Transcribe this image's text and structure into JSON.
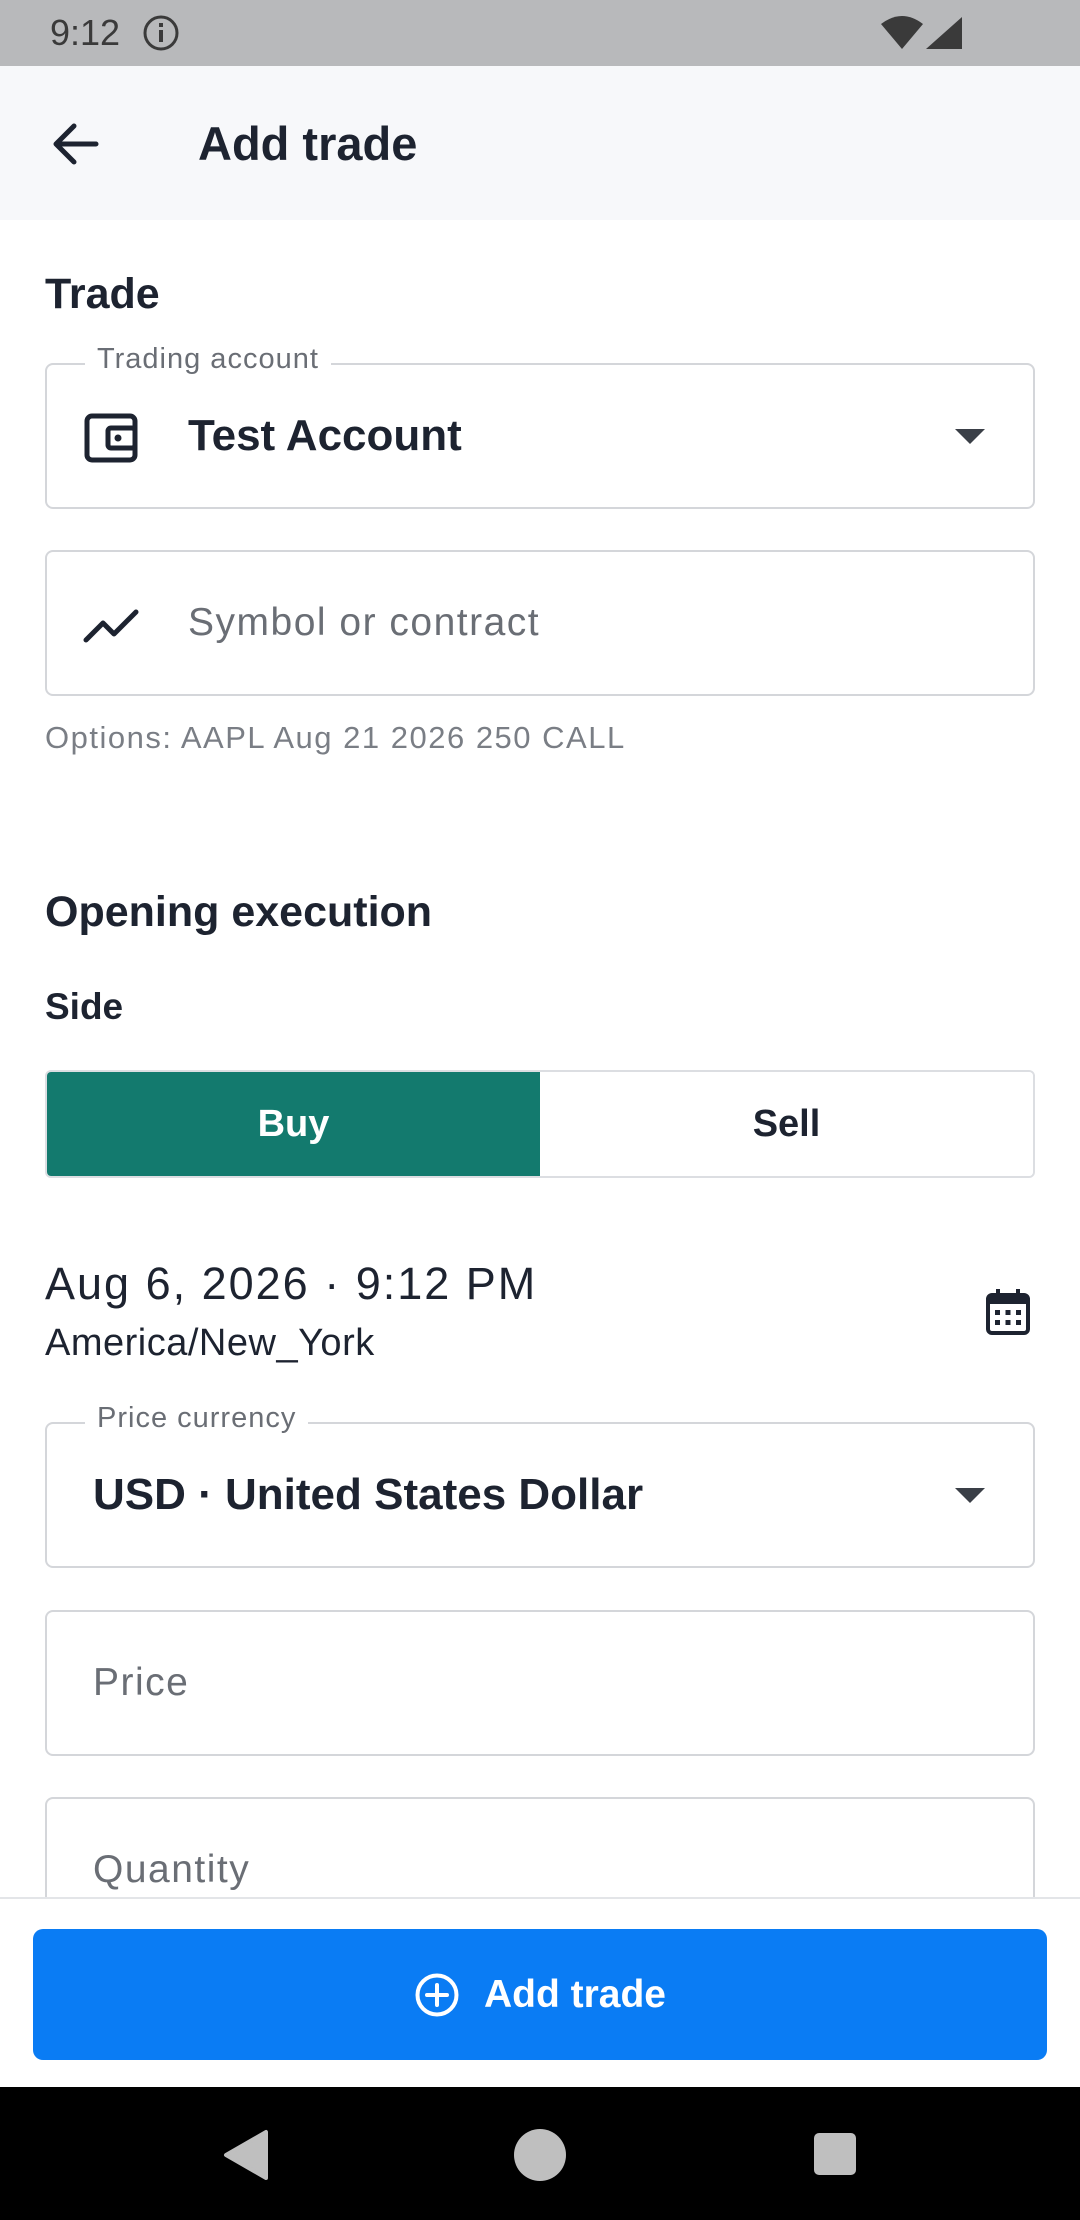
{
  "status_bar": {
    "time": "9:12"
  },
  "app_bar": {
    "title": "Add trade"
  },
  "trade_section": {
    "title": "Trade",
    "trading_account": {
      "label": "Trading account",
      "value": "Test Account"
    },
    "symbol": {
      "placeholder": "Symbol or contract",
      "helper": "Options: AAPL Aug 21 2026 250 CALL"
    }
  },
  "opening_section": {
    "title": "Opening execution",
    "side": {
      "label": "Side",
      "options": [
        "Buy",
        "Sell"
      ],
      "selected": "Buy"
    },
    "datetime": {
      "value": "Aug 6, 2026 · 9:12 PM",
      "timezone": "America/New_York"
    },
    "price_currency": {
      "label": "Price currency",
      "value": "USD · United States Dollar"
    },
    "price": {
      "placeholder": "Price"
    },
    "quantity": {
      "placeholder": "Quantity"
    }
  },
  "primary_action": {
    "label": "Add trade"
  },
  "colors": {
    "accent_buy": "#137a6e",
    "primary_button": "#0a7cf4",
    "app_bar_bg": "#f7f8fa",
    "status_bar_bg": "#b8b9bb"
  },
  "icons": {
    "back": "arrow-left-icon",
    "account": "wallet-icon",
    "symbol": "trending-up-icon",
    "calendar": "calendar-icon",
    "add": "plus-circle-icon"
  }
}
